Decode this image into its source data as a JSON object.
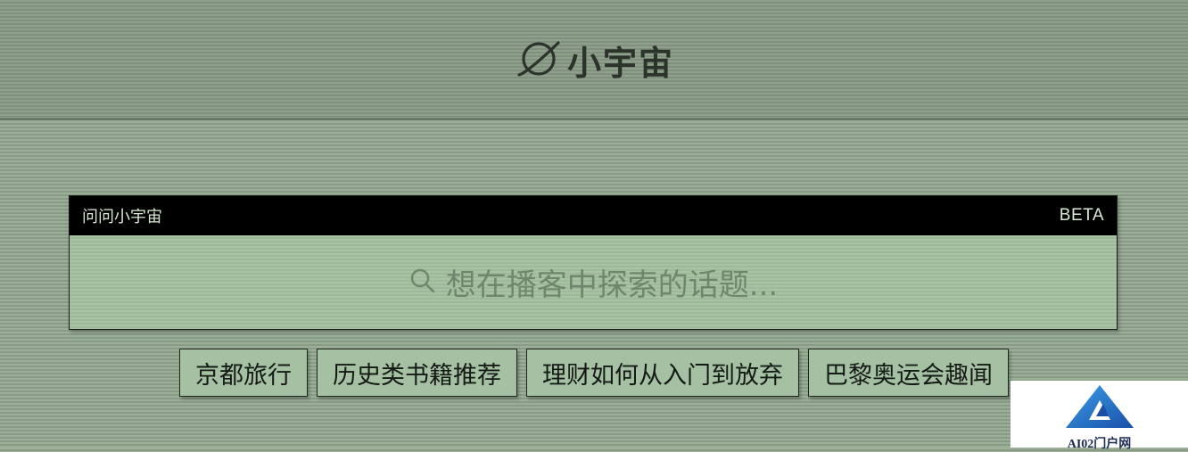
{
  "brand": {
    "name": "小宇宙",
    "icon": "planet-icon"
  },
  "ask": {
    "title": "问问小宇宙",
    "badge": "BETA",
    "search_icon": "search-icon",
    "placeholder": "想在播客中探索的话题..."
  },
  "topics": [
    {
      "label": "京都旅行"
    },
    {
      "label": "历史类书籍推荐"
    },
    {
      "label": "理财如何从入门到放弃"
    },
    {
      "label": "巴黎奥运会趣闻"
    }
  ],
  "watermark": {
    "text": "AI02门户网",
    "icon": "triangle-logo-icon"
  },
  "colors": {
    "background": "#90a38d",
    "card": "#a4c0a1",
    "bar": "#000000",
    "text_dark": "#141a14"
  }
}
